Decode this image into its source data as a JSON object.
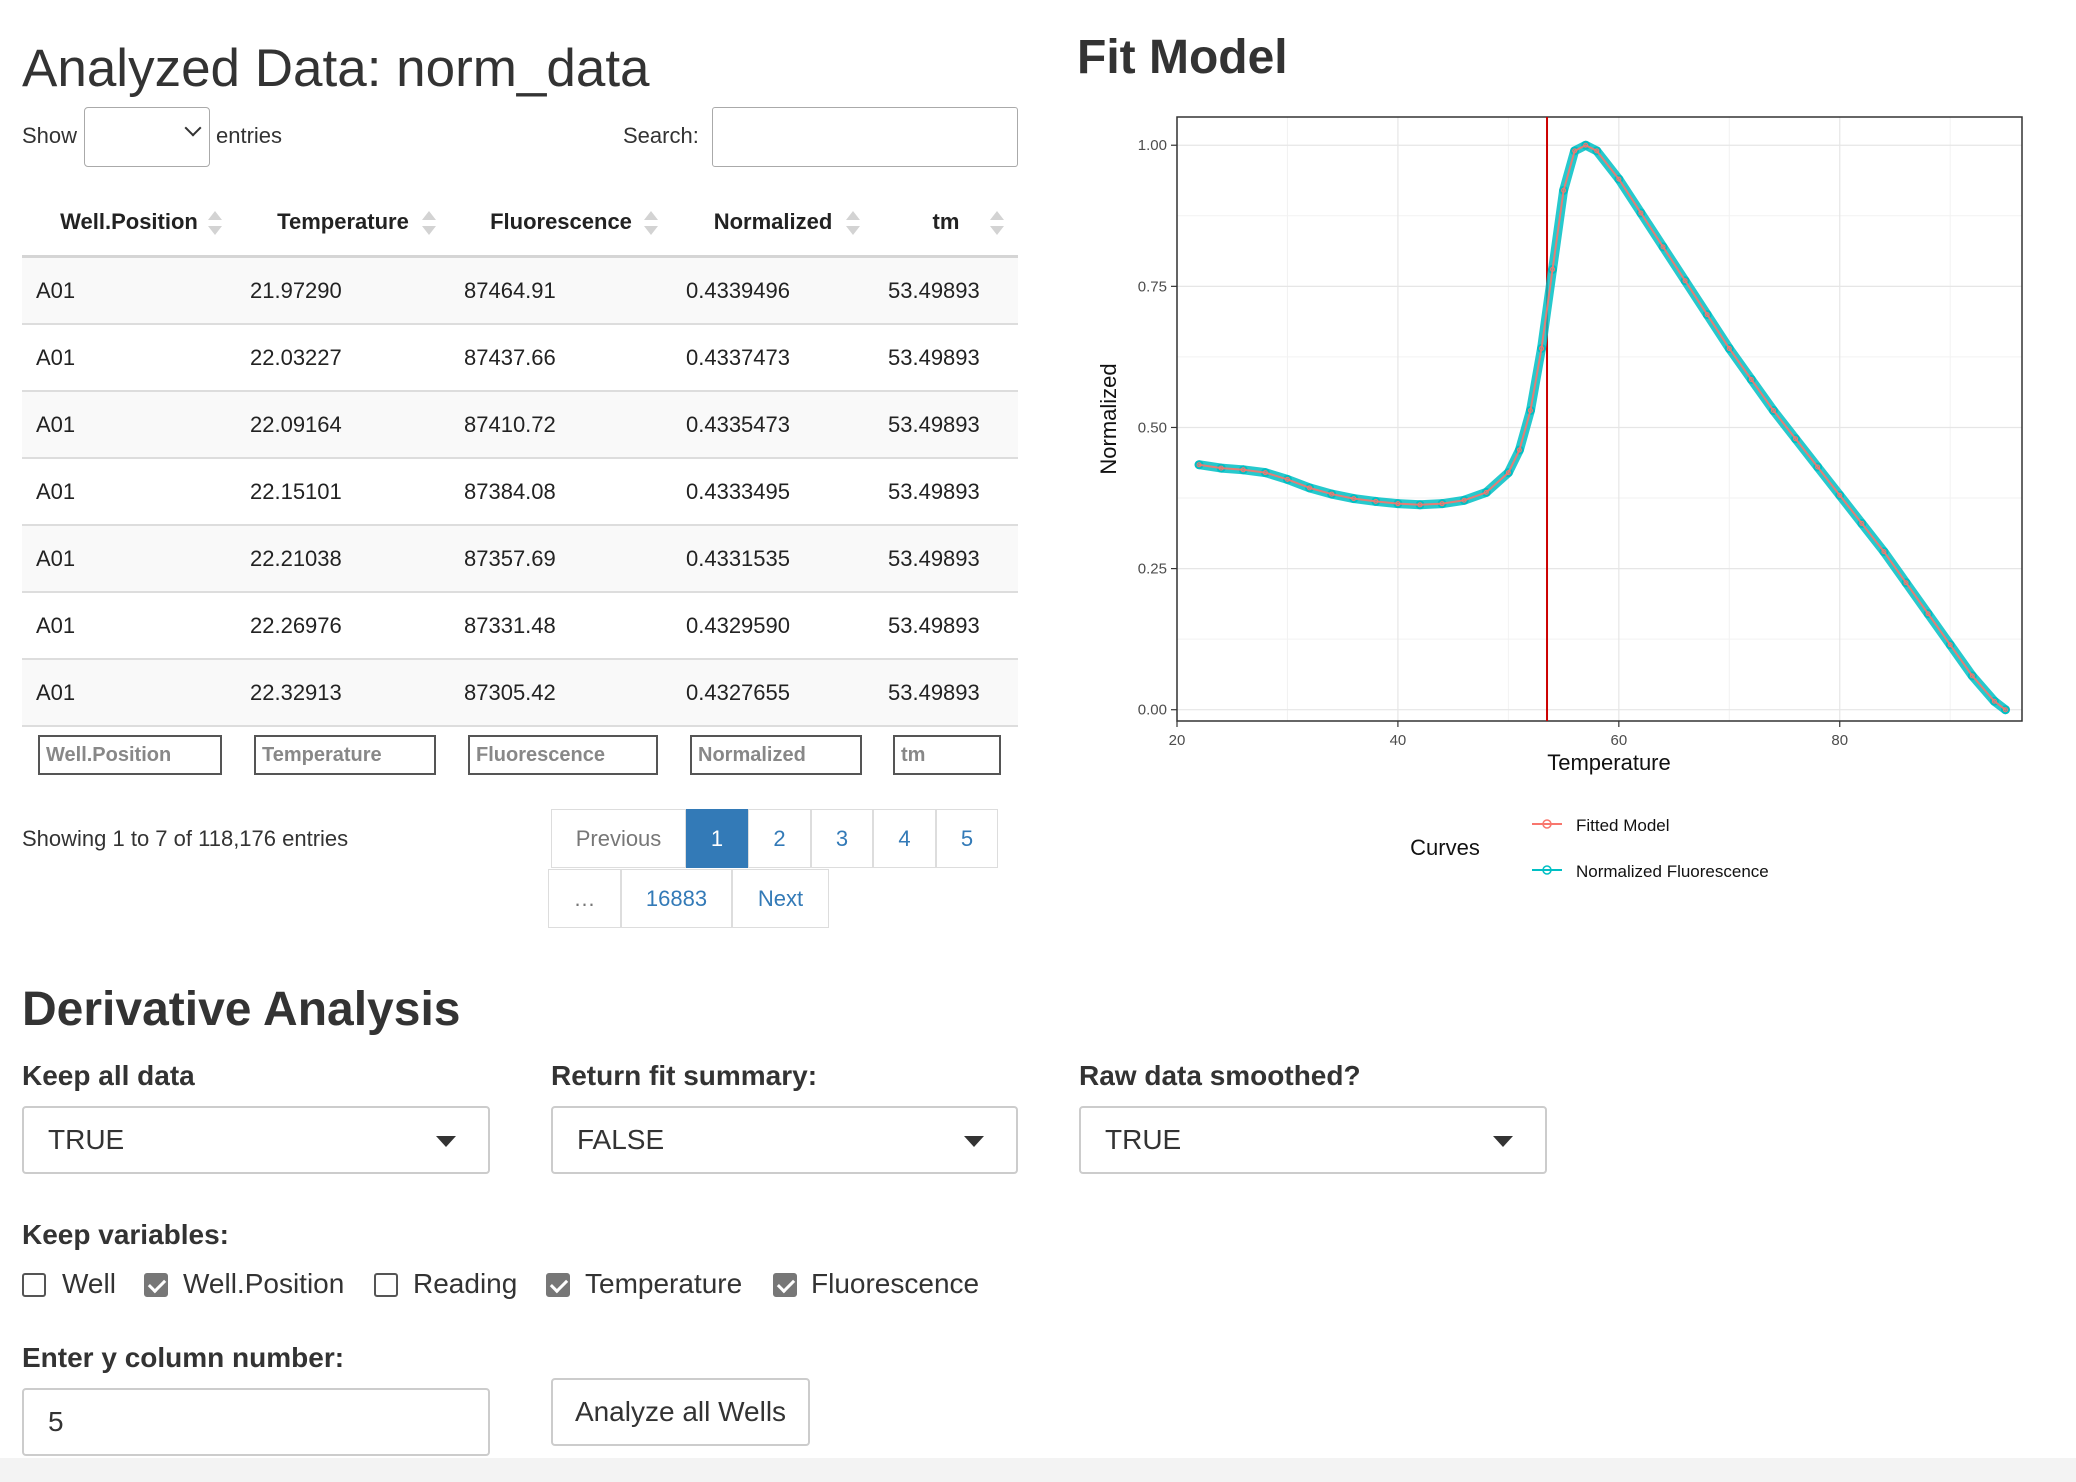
{
  "left_panel": {
    "title": "Analyzed Data: norm_data",
    "show_label": "Show",
    "show_value": "",
    "entries_label": "entries",
    "search_label": "Search:",
    "search_value": "",
    "columns": [
      "Well.Position",
      "Temperature",
      "Fluorescence",
      "Normalized",
      "tm"
    ],
    "rows": [
      [
        "A01",
        "21.97290",
        "87464.91",
        "0.4339496",
        "53.49893"
      ],
      [
        "A01",
        "22.03227",
        "87437.66",
        "0.4337473",
        "53.49893"
      ],
      [
        "A01",
        "22.09164",
        "87410.72",
        "0.4335473",
        "53.49893"
      ],
      [
        "A01",
        "22.15101",
        "87384.08",
        "0.4333495",
        "53.49893"
      ],
      [
        "A01",
        "22.21038",
        "87357.69",
        "0.4331535",
        "53.49893"
      ],
      [
        "A01",
        "22.26976",
        "87331.48",
        "0.4329590",
        "53.49893"
      ],
      [
        "A01",
        "22.32913",
        "87305.42",
        "0.4327655",
        "53.49893"
      ]
    ],
    "filters": [
      "Well.Position",
      "Temperature",
      "Fluorescence",
      "Normalized",
      "tm"
    ],
    "info": "Showing 1 to 7 of 118,176 entries",
    "pagination": {
      "previous": "Previous",
      "pages": [
        "1",
        "2",
        "3",
        "4",
        "5"
      ],
      "ellipsis": "…",
      "last": "16883",
      "next": "Next",
      "active_page": "1"
    }
  },
  "right_panel": {
    "title": "Fit Model"
  },
  "chart_data": {
    "type": "line",
    "title": "",
    "xlabel": "Temperature",
    "ylabel": "Normalized",
    "xlim": [
      20,
      96.5
    ],
    "ylim": [
      -0.02,
      1.05
    ],
    "x_ticks": [
      20,
      40,
      60,
      80
    ],
    "x_tick_labels": [
      "20",
      "40",
      "60",
      "80"
    ],
    "y_ticks": [
      0,
      0.25,
      0.5,
      0.75,
      1.0
    ],
    "y_tick_labels": [
      "0.00",
      "0.25",
      "0.50",
      "0.75",
      "1.00"
    ],
    "grid": true,
    "vline": {
      "x": 53.49893,
      "color": "#cc0000"
    },
    "legend": {
      "title": "Curves",
      "position": "bottom"
    },
    "series": [
      {
        "name": "Fitted Model",
        "color": "#f8766d",
        "x": [
          22,
          24,
          26,
          28,
          30,
          32,
          34,
          36,
          38,
          40,
          42,
          44,
          46,
          48,
          50,
          51,
          52,
          53,
          54,
          55,
          56,
          57,
          58,
          60,
          62,
          64,
          66,
          68,
          70,
          72,
          74,
          76,
          78,
          80,
          82,
          84,
          86,
          88,
          90,
          92,
          94,
          95
        ],
        "y": [
          0.434,
          0.428,
          0.425,
          0.42,
          0.408,
          0.393,
          0.382,
          0.374,
          0.369,
          0.365,
          0.363,
          0.365,
          0.371,
          0.385,
          0.42,
          0.46,
          0.53,
          0.64,
          0.78,
          0.92,
          0.99,
          1.0,
          0.99,
          0.94,
          0.88,
          0.82,
          0.76,
          0.7,
          0.64,
          0.585,
          0.53,
          0.48,
          0.43,
          0.38,
          0.33,
          0.28,
          0.225,
          0.17,
          0.115,
          0.06,
          0.015,
          0.0
        ]
      },
      {
        "name": "Normalized Fluorescence",
        "color": "#00bfc4",
        "x": [
          22,
          24,
          26,
          28,
          30,
          32,
          34,
          36,
          38,
          40,
          42,
          44,
          46,
          48,
          50,
          51,
          52,
          53,
          54,
          55,
          56,
          57,
          58,
          60,
          62,
          64,
          66,
          68,
          70,
          72,
          74,
          76,
          78,
          80,
          82,
          84,
          86,
          88,
          90,
          92,
          94,
          95
        ],
        "y": [
          0.434,
          0.428,
          0.425,
          0.42,
          0.408,
          0.393,
          0.382,
          0.374,
          0.369,
          0.365,
          0.363,
          0.365,
          0.371,
          0.385,
          0.42,
          0.46,
          0.53,
          0.64,
          0.78,
          0.92,
          0.99,
          1.0,
          0.99,
          0.94,
          0.88,
          0.82,
          0.76,
          0.7,
          0.64,
          0.585,
          0.53,
          0.48,
          0.43,
          0.38,
          0.33,
          0.28,
          0.225,
          0.17,
          0.115,
          0.06,
          0.015,
          0.0
        ]
      }
    ]
  },
  "derivative": {
    "title": "Derivative Analysis",
    "keep_all": {
      "label": "Keep all data",
      "value": "TRUE"
    },
    "fit_summary": {
      "label": "Return fit summary:",
      "value": "FALSE"
    },
    "smoothed": {
      "label": "Raw data smoothed?",
      "value": "TRUE"
    },
    "keep_vars_label": "Keep variables:",
    "keep_vars": [
      {
        "label": "Well",
        "checked": false
      },
      {
        "label": "Well.Position",
        "checked": true
      },
      {
        "label": "Reading",
        "checked": false
      },
      {
        "label": "Temperature",
        "checked": true
      },
      {
        "label": "Fluorescence",
        "checked": true
      }
    ],
    "y_col_label": "Enter y column number:",
    "y_col_value": "5",
    "analyze_button": "Analyze all Wells"
  }
}
